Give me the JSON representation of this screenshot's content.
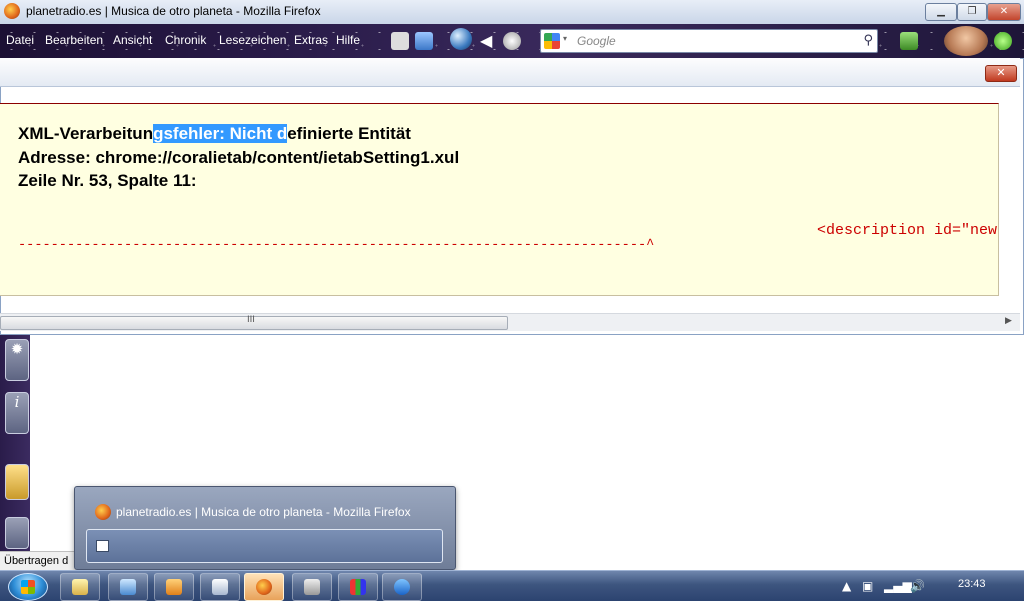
{
  "window": {
    "title": "planetradio.es | Musica de otro planeta - Mozilla Firefox",
    "minimize_glyph": "▁",
    "maximize_glyph": "❐",
    "close_glyph": "✕"
  },
  "menu": {
    "items": [
      "Datei",
      "Bearbeiten",
      "Ansicht",
      "Chronik",
      "Lesezeichen",
      "Extras",
      "Hilfe"
    ]
  },
  "search": {
    "placeholder": "Google",
    "icon": "magnifier-icon"
  },
  "content": {
    "close_label": "✕",
    "error": {
      "line1_before": "XML-Verarbeitun",
      "line1_selected": "gsfehler: Nicht d",
      "line1_after": "efinierte Entität",
      "line2": "Adresse: chrome://coralietab/content/ietabSetting1.xul",
      "line3": "Zeile Nr. 53, Spalte 11:",
      "source_line": "<description id=\"new",
      "dash_line": "-----------------------------------------------------------------------------^"
    },
    "scroll_grip": "III",
    "scroll_arrow": "▶"
  },
  "status_bar": {
    "text": "Übertragen d"
  },
  "popup": {
    "title": "planetradio.es | Musica de otro planeta - Mozilla Firefox"
  },
  "taskbar": {
    "clock": "23:43",
    "apps": [
      "explorer-icon",
      "network-icon",
      "media-player-icon",
      "copy-icon",
      "firefox-icon",
      "printer-icon",
      "chart-icon",
      "messenger-icon"
    ]
  },
  "colors": {
    "error_bg": "#ffffe1",
    "selection": "#3399ff",
    "source_red": "#cc0000",
    "menubar": "#2a1c4a"
  }
}
